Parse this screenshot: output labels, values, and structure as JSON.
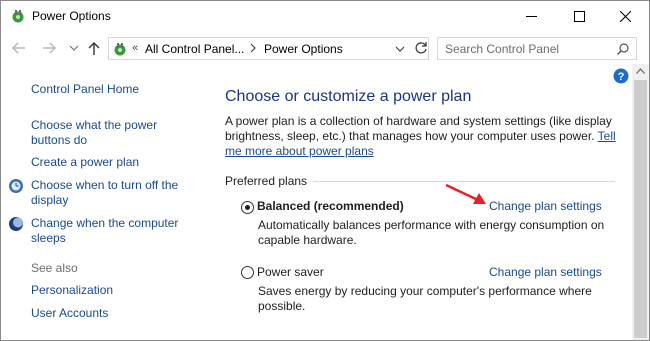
{
  "window": {
    "title": "Power Options"
  },
  "address": {
    "chevrons": "«",
    "segment_1": "All Control Panel...",
    "segment_2": "Power Options",
    "search_placeholder": "Search Control Panel"
  },
  "sidebar": {
    "home": "Control Panel Home",
    "links": [
      {
        "label": "Choose what the power buttons do",
        "icon": null
      },
      {
        "label": "Create a power plan",
        "icon": null
      },
      {
        "label": "Choose when to turn off the display",
        "icon": "monitor-icon"
      },
      {
        "label": "Change when the computer sleeps",
        "icon": "moon-icon"
      }
    ],
    "see_also": "See also",
    "see_also_links": [
      "Personalization",
      "User Accounts"
    ]
  },
  "main": {
    "title": "Choose or customize a power plan",
    "intro_text": "A power plan is a collection of hardware and system settings (like display brightness, sleep, etc.) that manages how your computer uses power.",
    "intro_link": "Tell me more about power plans",
    "group_label": "Preferred plans",
    "plans": [
      {
        "name": "Balanced (recommended)",
        "selected": true,
        "description": "Automatically balances performance with energy consumption on capable hardware.",
        "link": "Change plan settings"
      },
      {
        "name": "Power saver",
        "selected": false,
        "description": "Saves energy by reducing your computer's performance where possible.",
        "link": "Change plan settings"
      }
    ]
  },
  "colors": {
    "link": "#1a4b8c",
    "title": "#1e3287",
    "arrow": "#e8202a"
  }
}
